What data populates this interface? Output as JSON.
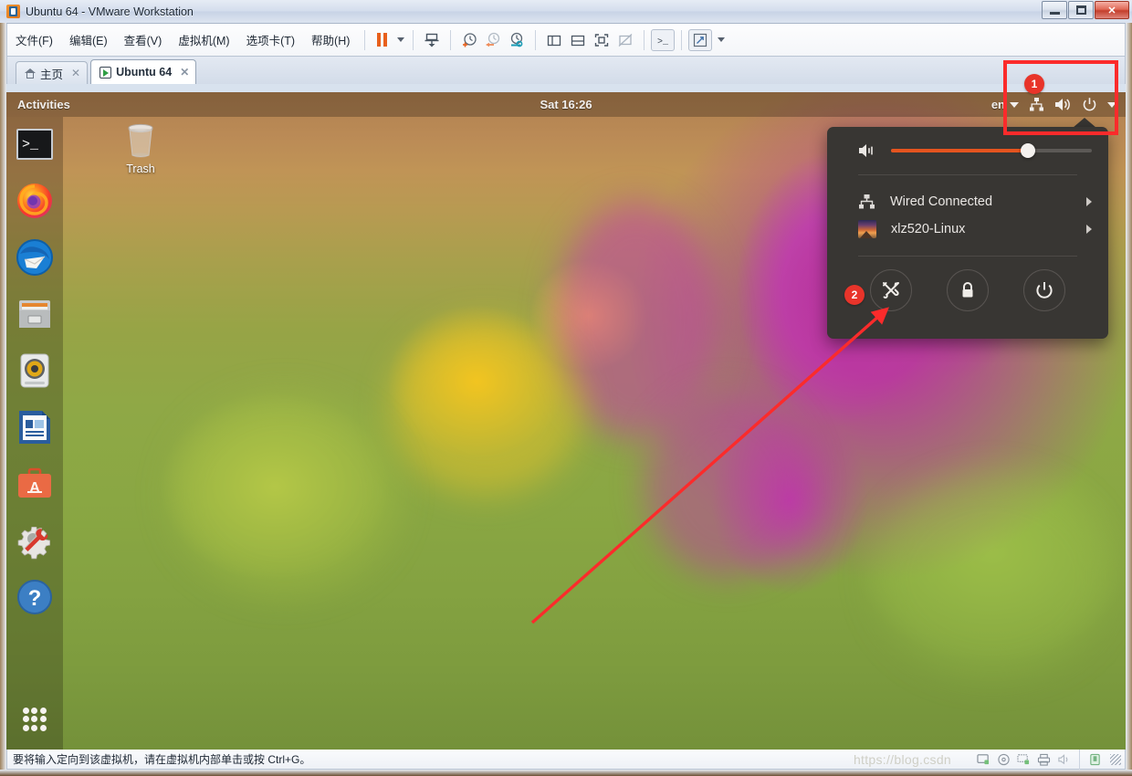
{
  "window": {
    "title": "Ubuntu 64  - VMware Workstation",
    "app_icon": "vmware-icon",
    "minimize_label": "Minimize",
    "maximize_label": "Restore",
    "close_label": "✕"
  },
  "menubar": {
    "items": [
      {
        "label": "文件(F)",
        "name": "menu-file"
      },
      {
        "label": "编辑(E)",
        "name": "menu-edit"
      },
      {
        "label": "查看(V)",
        "name": "menu-view"
      },
      {
        "label": "虚拟机(M)",
        "name": "menu-vm"
      },
      {
        "label": "选项卡(T)",
        "name": "menu-tabs"
      },
      {
        "label": "帮助(H)",
        "name": "menu-help"
      }
    ],
    "toolbar_icons": [
      "suspend-icon",
      "suspend-dropdown-caret",
      "power-down-icon",
      "snapshot-take-icon",
      "snapshot-revert-icon",
      "snapshot-manager-icon",
      "show-sidebar-icon",
      "show-console-icon",
      "fullscreen-icon",
      "unity-mode-icon",
      "terminal-icon",
      "stretch-icon",
      "stretch-dropdown-caret"
    ]
  },
  "tabs": [
    {
      "label": "主页",
      "icon": "home-icon",
      "active": false,
      "close": "✕"
    },
    {
      "label": "Ubuntu 64",
      "icon": "vm-running-icon",
      "active": true,
      "close": "✕"
    }
  ],
  "guest": {
    "topbar": {
      "activities": "Activities",
      "clock": "Sat 16:26",
      "language": "en",
      "tray_icons": [
        "network-wired-icon",
        "volume-icon",
        "power-icon",
        "chevron-down-icon"
      ]
    },
    "dock": {
      "items": [
        {
          "name": "dock-item-terminal",
          "icon": "terminal-icon",
          "label": "Terminal"
        },
        {
          "name": "dock-item-firefox",
          "icon": "firefox-icon",
          "label": "Firefox"
        },
        {
          "name": "dock-item-thunderbird",
          "icon": "thunderbird-icon",
          "label": "Thunderbird Mail"
        },
        {
          "name": "dock-item-files",
          "icon": "files-cabinet-icon",
          "label": "Files"
        },
        {
          "name": "dock-item-rhythmbox",
          "icon": "rhythmbox-icon",
          "label": "Rhythmbox"
        },
        {
          "name": "dock-item-libreoffice-writer",
          "icon": "libreoffice-writer-icon",
          "label": "LibreOffice Writer"
        },
        {
          "name": "dock-item-software",
          "icon": "ubuntu-software-icon",
          "label": "Ubuntu Software"
        },
        {
          "name": "dock-item-settings-tools",
          "icon": "gear-wrench-icon",
          "label": "Settings"
        },
        {
          "name": "dock-item-help",
          "icon": "help-question-icon",
          "label": "Help"
        }
      ],
      "show_apps_label": "Show Applications"
    },
    "desktop": {
      "icons": [
        {
          "name": "desktop-icon-trash",
          "label": "Trash",
          "icon": "trash-icon"
        }
      ]
    },
    "system_menu": {
      "volume": {
        "icon": "volume-icon",
        "value": 68,
        "accent": "#e5541f"
      },
      "rows": [
        {
          "name": "menu-row-network",
          "icon": "network-wired-icon",
          "label": "Wired Connected",
          "chevron": true
        },
        {
          "name": "menu-row-user",
          "icon": "user-avatar",
          "label": "xlz520-Linux",
          "chevron": true
        }
      ],
      "actions": [
        {
          "name": "settings-button",
          "icon": "tools-icon",
          "label": "Settings"
        },
        {
          "name": "lock-button",
          "icon": "lock-icon",
          "label": "Lock"
        },
        {
          "name": "power-button",
          "icon": "power-icon",
          "label": "Power Off"
        }
      ]
    }
  },
  "annotations": [
    {
      "name": "annotation-badge-1",
      "number": "1",
      "target": "system-tray"
    },
    {
      "name": "annotation-badge-2",
      "number": "2",
      "target": "settings-button"
    }
  ],
  "statusbar": {
    "message": "要将输入定向到该虚拟机，请在虚拟机内部单击或按 Ctrl+G。",
    "watermark": "https://blog.csdn",
    "icons": [
      "removable-device-icon",
      "cd-drive-icon",
      "network-adapter-icon",
      "printer-icon",
      "sound-device-icon",
      "usb-device-icon"
    ]
  },
  "colors": {
    "accent_orange": "#e5541f",
    "annotation_red": "#fb2b2b",
    "badge_red": "#e8342a",
    "menu_bg": "#383633"
  }
}
